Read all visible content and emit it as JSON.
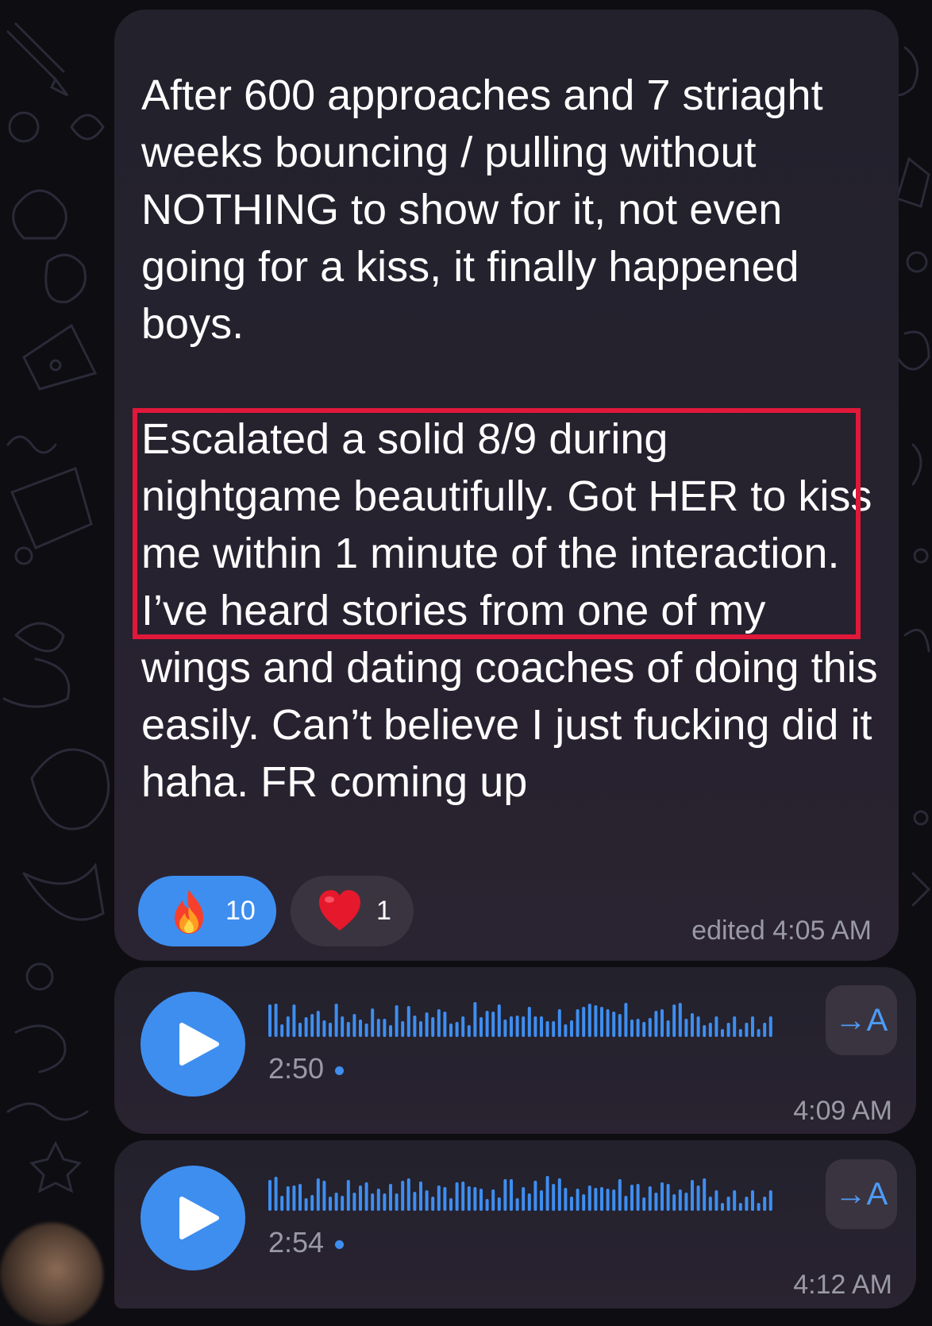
{
  "message": {
    "paragraph1": "After 600 approaches and 7 striaght weeks bouncing / pulling without NOTHING to show for it, not even going for a kiss, it finally happened boys.",
    "paragraph2_highlighted": "Escalated a solid 8/9 during nightgame beautifully. Got HER to kiss me within 1 minute of the interaction. I’ve heard stories from",
    "paragraph2_rest": "one of my wings and dating coaches of doing this easily. Can’t believe I just fucking did it haha. FR coming up",
    "timestamp": "edited 4:05 AM",
    "highlight_color": "#e0183a",
    "reactions": [
      {
        "emoji": "fire",
        "count": "10",
        "selected": true
      },
      {
        "emoji": "red-heart",
        "count": "1",
        "selected": false
      }
    ]
  },
  "voice_messages": [
    {
      "duration": "2:50",
      "timestamp": "4:09 AM",
      "transcribe_label": "→A",
      "unread": true
    },
    {
      "duration": "2:54",
      "timestamp": "4:12 AM",
      "transcribe_label": "→A",
      "unread": true
    }
  ],
  "colors": {
    "accent": "#3e8ef0",
    "bubble": "#26232e",
    "background": "#0d0d12",
    "secondary_text": "#9a9aa6"
  }
}
